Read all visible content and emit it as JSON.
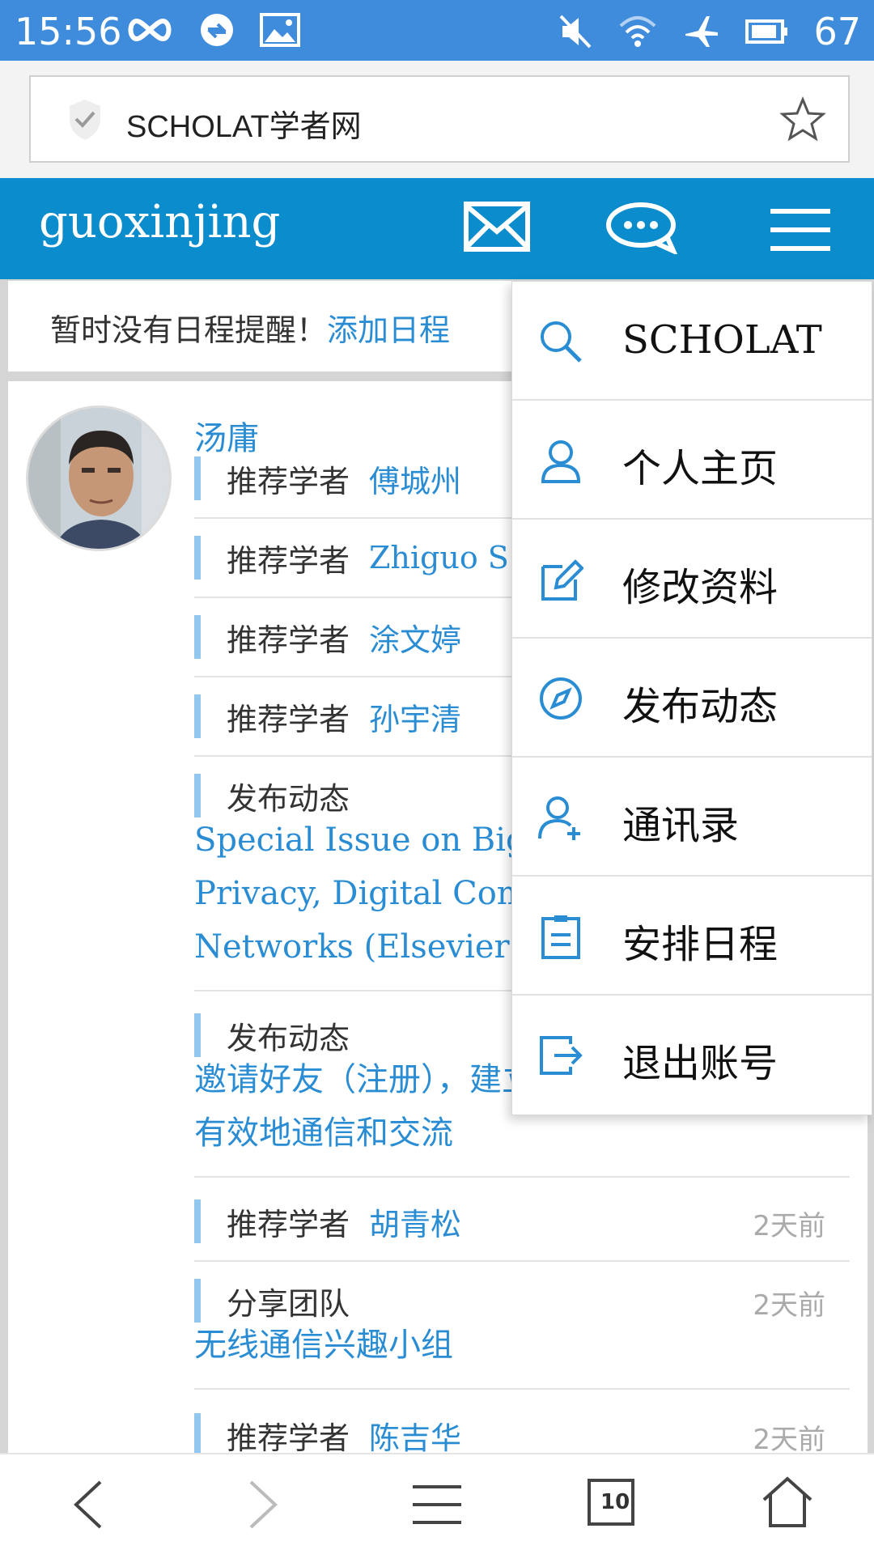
{
  "status_bar": {
    "time": "15:56",
    "battery": "67"
  },
  "browser": {
    "page_title": "SCHOLAT学者网",
    "tab_count": "10"
  },
  "header": {
    "username": "guoxinjing"
  },
  "notice": {
    "text": "暂时没有日程提醒！",
    "link": "添加日程"
  },
  "feed": {
    "author": "汤庸",
    "items": [
      {
        "type": "推荐学者",
        "name": "傅城州"
      },
      {
        "type": "推荐学者",
        "name": "Zhiguo S"
      },
      {
        "type": "推荐学者",
        "name": "涂文婷"
      },
      {
        "type": "推荐学者",
        "name": "孙宇清"
      },
      {
        "type": "发布动态",
        "body1": "Special Issue on Big",
        "body2": "Privacy, Digital Com",
        "body3": "Networks (Elsevier)"
      },
      {
        "type": "发布动态",
        "body1": "邀请好友（注册），建立自己的学术圈，更",
        "body2": "有效地通信和交流"
      },
      {
        "type": "推荐学者",
        "name": "胡青松",
        "time": "2天前"
      },
      {
        "type": "分享团队",
        "time": "2天前",
        "body1": "无线通信兴趣小组"
      },
      {
        "type": "推荐学者",
        "name": "陈吉华",
        "time": "2天前"
      }
    ]
  },
  "menu": {
    "items": [
      {
        "label": "SCHOLAT",
        "icon": "search-icon"
      },
      {
        "label": "个人主页",
        "icon": "user-icon"
      },
      {
        "label": "修改资料",
        "icon": "edit-icon"
      },
      {
        "label": "发布动态",
        "icon": "compass-icon"
      },
      {
        "label": "通讯录",
        "icon": "add-contact-icon"
      },
      {
        "label": "安排日程",
        "icon": "clipboard-icon"
      },
      {
        "label": "退出账号",
        "icon": "logout-icon"
      }
    ]
  },
  "colors": {
    "status_bar": "#3f8bdc",
    "header": "#0a8ccd",
    "link": "#2a8dd4",
    "accent_bar": "#92c7f0"
  }
}
